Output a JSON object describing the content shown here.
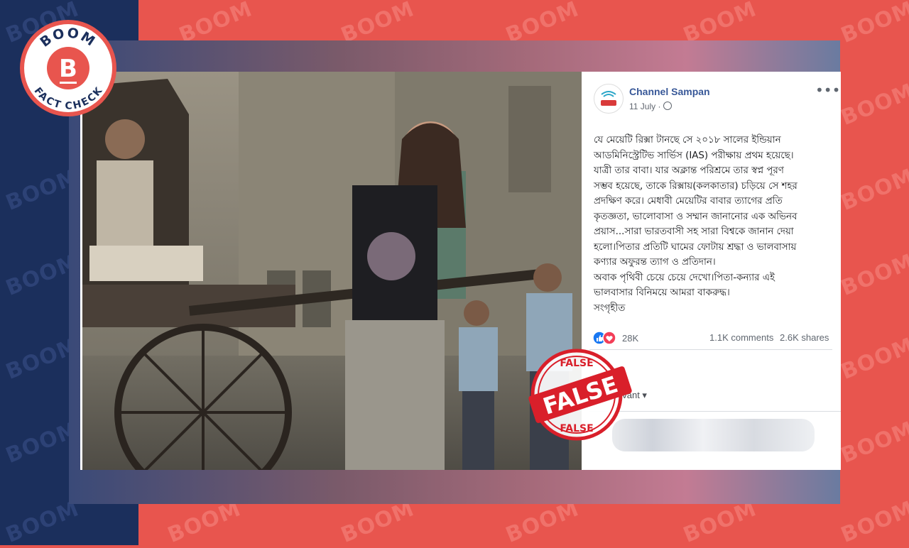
{
  "watermark": {
    "text": "BOOM"
  },
  "logo": {
    "top_text": "BOOM",
    "letter": "B",
    "bottom_text": "FACT CHECK"
  },
  "stamp": {
    "main": "FALSE",
    "top": "FALSE",
    "bottom": "FALSE"
  },
  "post": {
    "channel_name": "Channel Sampan",
    "date": "11 July · ",
    "more_label": "•••",
    "text_lines": [
      "যে মেয়েটি রিক্সা টানছে সে ২০১৮ সালের ইন্ডিয়ান",
      "আডমিনিস্ট্রেটিভ সার্ভিস (IAS) পরীক্ষায় প্রথম হয়েছে।",
      "যাত্রী তার বাবা। যার অক্লান্ত পরিশ্রমে তার স্বপ্ন পূরণ",
      "সম্ভব হয়েছে, তাকে রিক্সায়(কলকাতার) চড়িয়ে সে শহর",
      "প্রদক্ষিণ করে। মেধাবী মেয়েটির বাবার ত্যাগের প্রতি",
      "কৃতজ্ঞতা, ভালোবাসা ও সম্মান জানানোর এক অভিনব",
      "প্রয়াস...সারা ভারতবাসী সহ সারা বিশ্বকে জানান দেয়া",
      "হলো।পিতার প্রতিটি ঘামের ফোটায় শ্রদ্ধা ও ভালবাসায়",
      "কণ্যার অফুরন্ত ত্যাগ ও প্রতিদান।",
      "অবাক পৃথিবী চেয়ে চেয়ে দেখো।পিতা-কন্যার এই",
      "ভালবাসার বিনিময়ে আমরা বাকরুদ্ধ।",
      "সংগৃহীত"
    ],
    "reactions_count": "28K",
    "comments": "1.1K comments",
    "shares": "2.6K shares",
    "relevant_label": "evant ▾"
  },
  "colors": {
    "brand_red": "#e8554e",
    "brand_navy": "#1b2f5c",
    "facebook_blue": "#385898",
    "like_blue": "#1877f2",
    "love_red": "#f33e58"
  }
}
